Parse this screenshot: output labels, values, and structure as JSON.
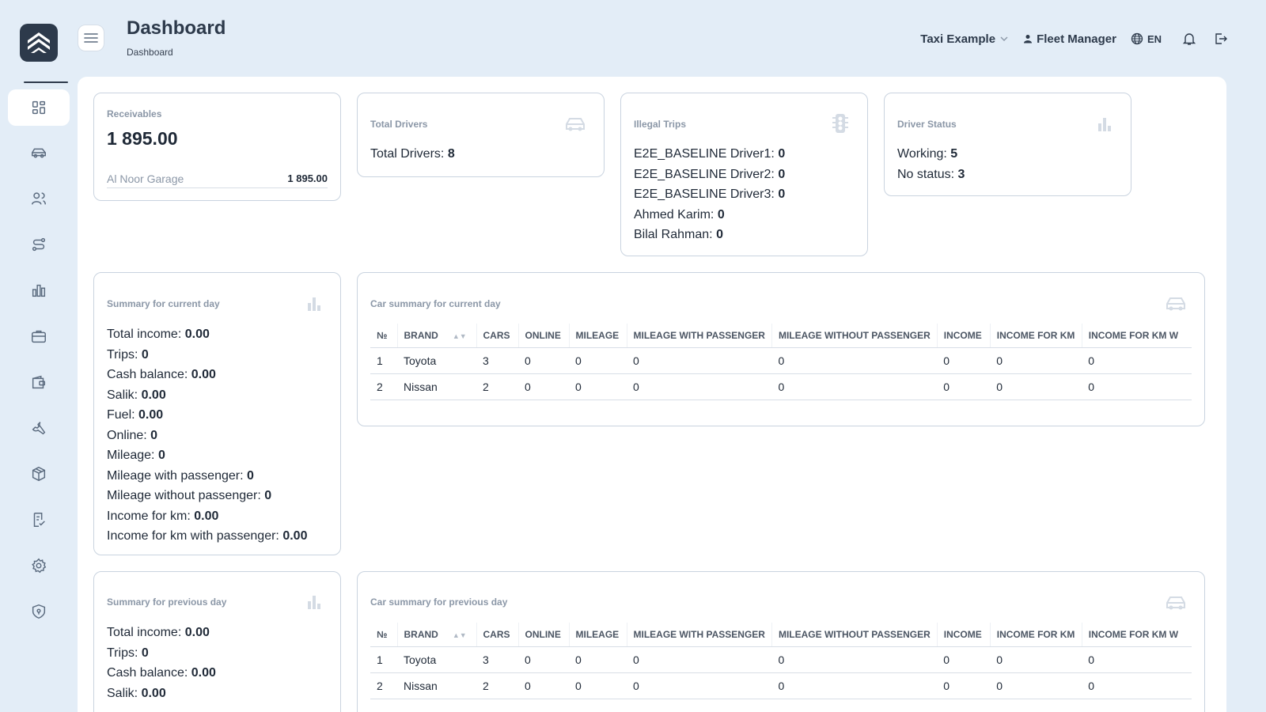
{
  "app": {
    "brand_color": "#2d3a4b",
    "background": "#e3edf7"
  },
  "header": {
    "title": "Dashboard",
    "breadcrumb": "Dashboard",
    "company": "Taxi Example",
    "role": "Fleet Manager",
    "language": "EN"
  },
  "sidebar": {
    "items": [
      {
        "icon": "dashboard-icon",
        "active": true
      },
      {
        "icon": "car-icon"
      },
      {
        "icon": "users-icon"
      },
      {
        "icon": "route-icon"
      },
      {
        "icon": "chart-icon"
      },
      {
        "icon": "briefcase-icon"
      },
      {
        "icon": "wallet-icon"
      },
      {
        "icon": "wrench-icon"
      },
      {
        "icon": "box-icon"
      },
      {
        "icon": "checklist-icon"
      },
      {
        "icon": "settings-icon"
      },
      {
        "icon": "shield-icon"
      }
    ]
  },
  "receivables": {
    "title": "Receivables",
    "amount": "1 895.00",
    "row_name": "Al Noor Garage",
    "row_value": "1 895.00"
  },
  "total_drivers": {
    "title": "Total Drivers",
    "label": "Total Drivers:",
    "value": "8"
  },
  "illegal_trips": {
    "title": "Illegal Trips",
    "rows": [
      {
        "label": "E2E_BASELINE Driver1:",
        "value": "0"
      },
      {
        "label": "E2E_BASELINE Driver2:",
        "value": "0"
      },
      {
        "label": "E2E_BASELINE Driver3:",
        "value": "0"
      },
      {
        "label": "Ahmed Karim:",
        "value": "0"
      },
      {
        "label": "Bilal Rahman:",
        "value": "0"
      }
    ]
  },
  "driver_status": {
    "title": "Driver Status",
    "rows": [
      {
        "label": "Working:",
        "value": "5"
      },
      {
        "label": "No status:",
        "value": "3"
      }
    ]
  },
  "summary_current": {
    "title": "Summary for current day",
    "rows": [
      {
        "label": "Total income:",
        "value": "0.00"
      },
      {
        "label": "Trips:",
        "value": "0"
      },
      {
        "label": "Cash balance:",
        "value": "0.00"
      },
      {
        "label": "Salik:",
        "value": "0.00"
      },
      {
        "label": "Fuel:",
        "value": "0.00"
      },
      {
        "label": "Online:",
        "value": "0"
      },
      {
        "label": "Mileage:",
        "value": "0"
      },
      {
        "label": "Mileage with passenger:",
        "value": "0"
      },
      {
        "label": "Mileage without passenger:",
        "value": "0"
      },
      {
        "label": "Income for km:",
        "value": "0.00"
      },
      {
        "label": "Income for km with passenger:",
        "value": "0.00"
      }
    ]
  },
  "summary_previous": {
    "title": "Summary for previous day",
    "rows": [
      {
        "label": "Total income:",
        "value": "0.00"
      },
      {
        "label": "Trips:",
        "value": "0"
      },
      {
        "label": "Cash balance:",
        "value": "0.00"
      },
      {
        "label": "Salik:",
        "value": "0.00"
      }
    ]
  },
  "car_summary_current": {
    "title": "Car summary for current day",
    "columns": [
      "№",
      "Brand",
      "Cars",
      "Online",
      "Mileage",
      "Mileage with passenger",
      "Mileage without passenger",
      "Income",
      "Income for km",
      "Income for km w"
    ],
    "rows": [
      [
        "1",
        "Toyota",
        "3",
        "0",
        "0",
        "0",
        "0",
        "0",
        "0",
        "0"
      ],
      [
        "2",
        "Nissan",
        "2",
        "0",
        "0",
        "0",
        "0",
        "0",
        "0",
        "0"
      ]
    ]
  },
  "car_summary_previous": {
    "title": "Car summary for previous day",
    "columns": [
      "№",
      "Brand",
      "Cars",
      "Online",
      "Mileage",
      "Mileage with passenger",
      "Mileage without passenger",
      "Income",
      "Income for km",
      "Income for km w"
    ],
    "rows": [
      [
        "1",
        "Toyota",
        "3",
        "0",
        "0",
        "0",
        "0",
        "0",
        "0",
        "0"
      ],
      [
        "2",
        "Nissan",
        "2",
        "0",
        "0",
        "0",
        "0",
        "0",
        "0",
        "0"
      ]
    ]
  }
}
